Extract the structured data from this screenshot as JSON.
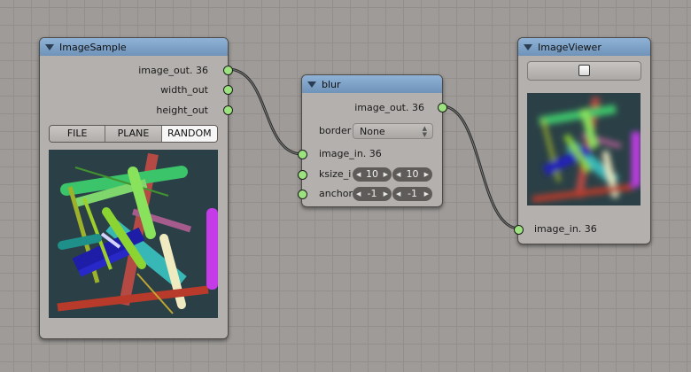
{
  "colors": {
    "canvas_bg": "#9e9b98",
    "node_bg": "#b3b0ad",
    "header": "#7fa3c8",
    "socket": "#9ce27f",
    "wire": "#2b2b2b",
    "preview_bg": "#2a4046"
  },
  "nodes": {
    "image_sample": {
      "title": "ImageSample",
      "outputs": [
        "image_out. 36",
        "width_out",
        "height_out"
      ],
      "tabs": [
        "FILE",
        "PLANE",
        "RANDOM"
      ],
      "active_tab": "RANDOM"
    },
    "blur": {
      "title": "blur",
      "output": "image_out. 36",
      "border_label": "border",
      "border_value": "None",
      "input": "image_in. 36",
      "ksize_label": "ksize_i",
      "ksize_values": [
        "10",
        "10"
      ],
      "anchor_label": "anchor",
      "anchor_values": [
        "-1",
        "-1"
      ]
    },
    "image_viewer": {
      "title": "ImageViewer",
      "input": "image_in. 36"
    }
  }
}
